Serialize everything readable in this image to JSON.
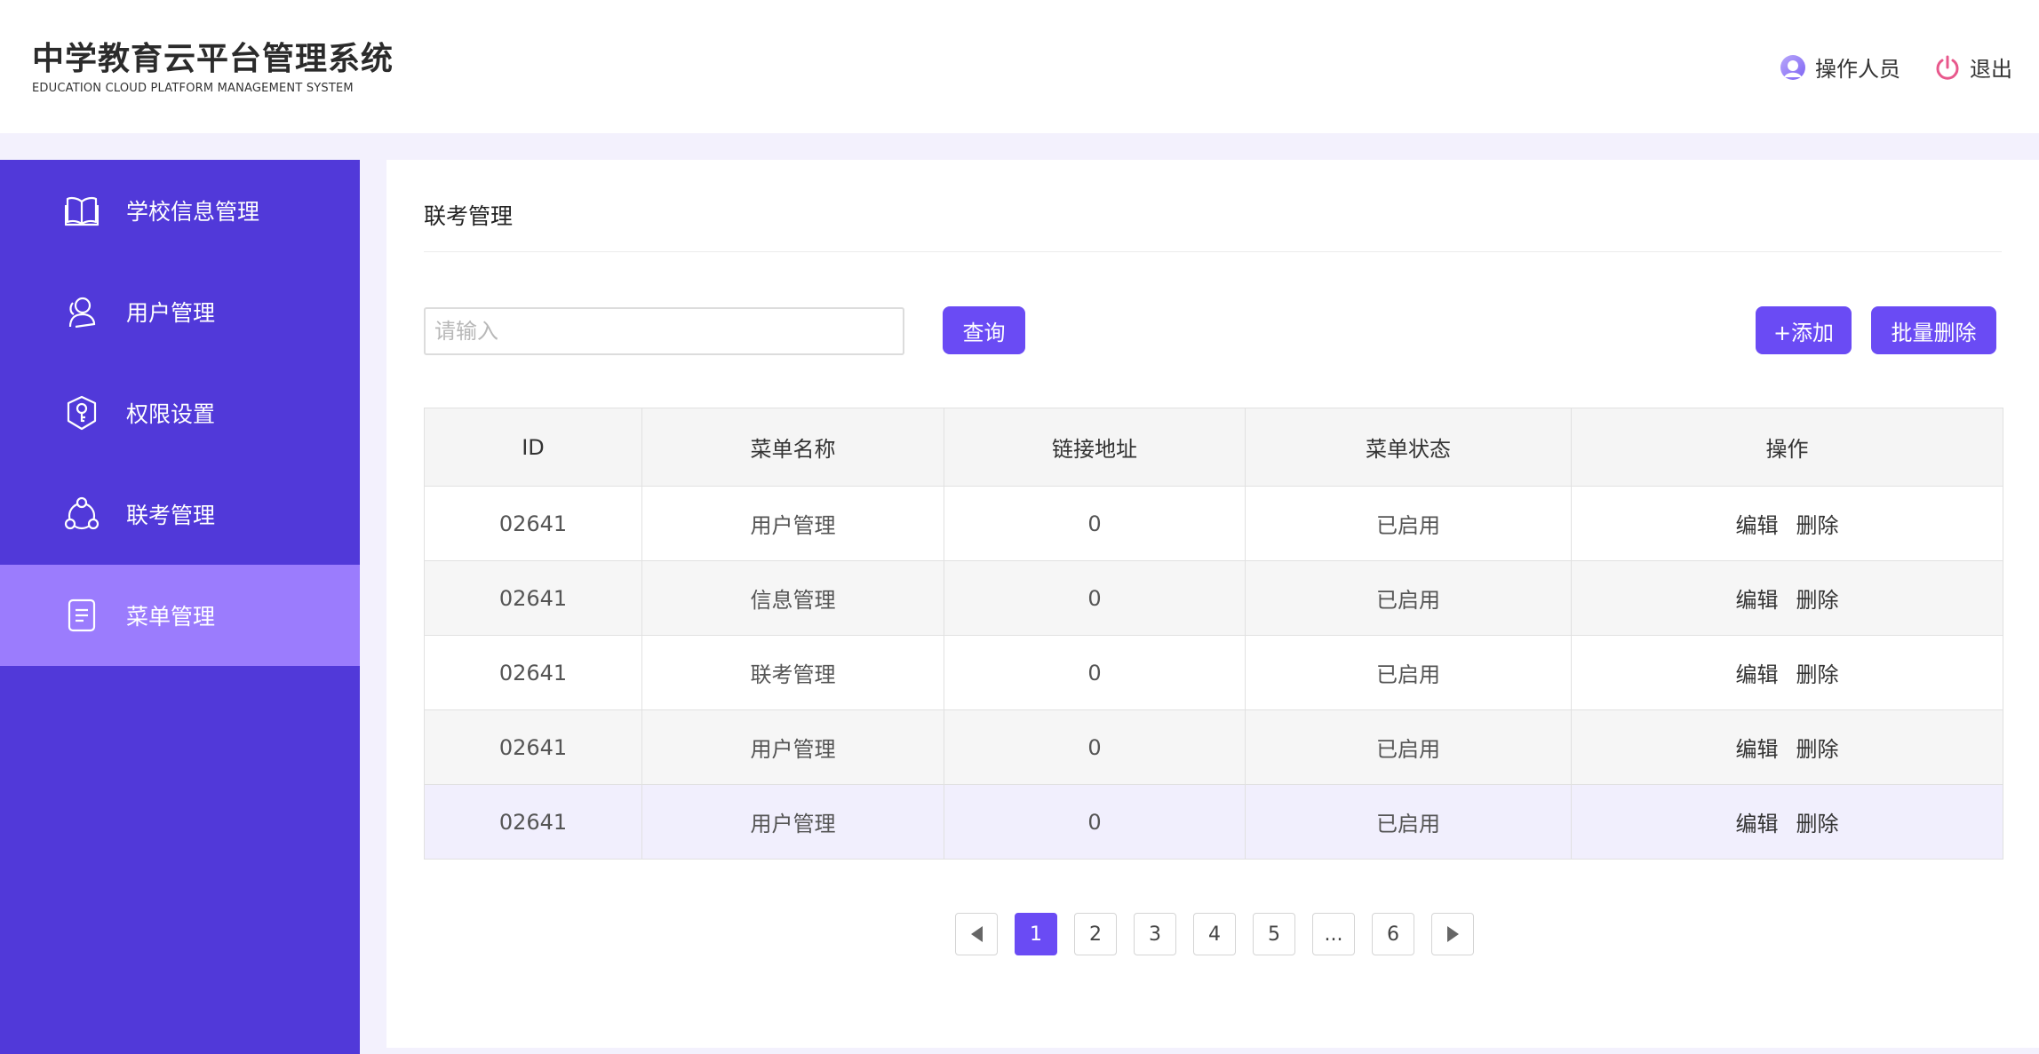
{
  "header": {
    "title": "中学教育云平台管理系统",
    "subtitle": "EDUCATION CLOUD PLATFORM MANAGEMENT SYSTEM",
    "operator_label": "操作人员",
    "logout_label": "退出"
  },
  "sidebar": {
    "items": [
      {
        "label": "学校信息管理",
        "icon": "book-icon"
      },
      {
        "label": "用户管理",
        "icon": "user-icon"
      },
      {
        "label": "权限设置",
        "icon": "shield-key-icon"
      },
      {
        "label": "联考管理",
        "icon": "share-nodes-icon"
      },
      {
        "label": "菜单管理",
        "icon": "document-icon",
        "active": true
      }
    ]
  },
  "main": {
    "title": "联考管理",
    "search": {
      "placeholder": "请输入",
      "value": ""
    },
    "query_label": "查询",
    "add_label": "+添加",
    "batch_delete_label": "批量删除"
  },
  "table": {
    "columns": [
      "ID",
      "菜单名称",
      "链接地址",
      "菜单状态",
      "操作"
    ],
    "rows": [
      {
        "id": "02641",
        "name": "用户管理",
        "link": "0",
        "status": "已启用",
        "edit": "编辑",
        "delete": "删除"
      },
      {
        "id": "02641",
        "name": "信息管理",
        "link": "0",
        "status": "已启用",
        "edit": "编辑",
        "delete": "删除"
      },
      {
        "id": "02641",
        "name": "联考管理",
        "link": "0",
        "status": "已启用",
        "edit": "编辑",
        "delete": "删除"
      },
      {
        "id": "02641",
        "name": "用户管理",
        "link": "0",
        "status": "已启用",
        "edit": "编辑",
        "delete": "删除"
      },
      {
        "id": "02641",
        "name": "用户管理",
        "link": "0",
        "status": "已启用",
        "edit": "编辑",
        "delete": "删除"
      }
    ]
  },
  "pagination": {
    "pages": [
      "1",
      "2",
      "3",
      "4",
      "5",
      "...",
      "6"
    ],
    "current": "1"
  },
  "colors": {
    "sidebar": "#5139d9",
    "sidebar_active": "#9b7cfd",
    "accent": "#6a4bf4",
    "logout_icon": "#e8588c"
  }
}
